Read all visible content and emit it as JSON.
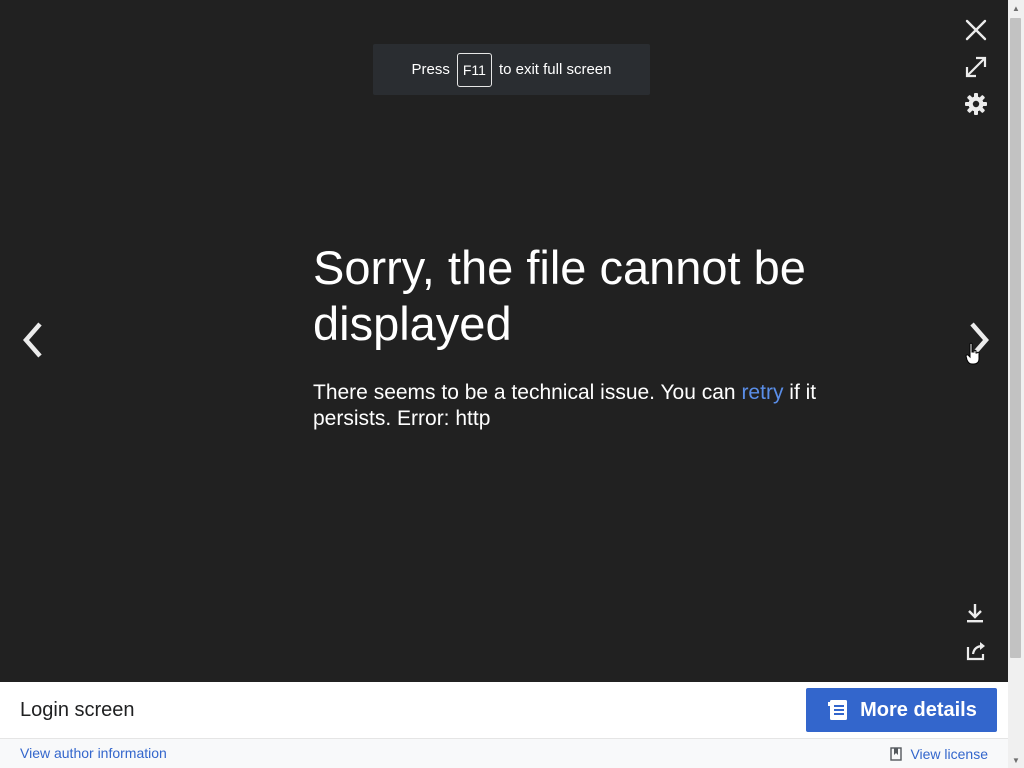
{
  "fullscreen_hint": {
    "prefix": "Press",
    "key": "F11",
    "suffix": "to exit full screen"
  },
  "controls": {
    "close_icon": "close-icon",
    "fullscreen_icon": "fullscreen-icon",
    "settings_icon": "gear-icon",
    "prev_icon": "chevron-left-icon",
    "next_icon": "chevron-right-icon",
    "download_icon": "download-icon",
    "share_icon": "share-icon"
  },
  "error": {
    "title": "Sorry, the file cannot be displayed",
    "message_before": "There seems to be a technical issue. You can ",
    "retry_label": "retry",
    "message_after": " if it persists. Error: http"
  },
  "metadata": {
    "file_title": "Login screen",
    "more_details_label": "More details",
    "author_link": "View author information",
    "license_link": "View license"
  },
  "colors": {
    "background": "#212121",
    "accent": "#3366cc",
    "link_on_dark": "#5a8ee8"
  }
}
